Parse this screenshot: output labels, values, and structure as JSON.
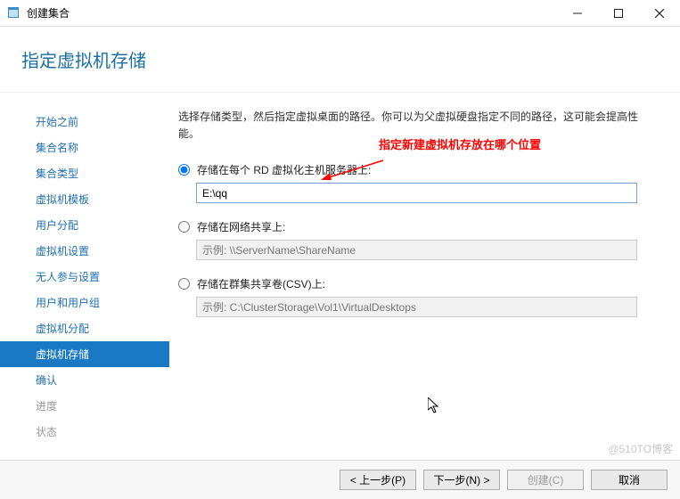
{
  "titlebar": {
    "title": "创建集合"
  },
  "header": {
    "title": "指定虚拟机存储"
  },
  "sidebar": {
    "items": [
      {
        "label": "开始之前"
      },
      {
        "label": "集合名称"
      },
      {
        "label": "集合类型"
      },
      {
        "label": "虚拟机模板"
      },
      {
        "label": "用户分配"
      },
      {
        "label": "虚拟机设置"
      },
      {
        "label": "无人参与设置"
      },
      {
        "label": "用户和用户组"
      },
      {
        "label": "虚拟机分配"
      },
      {
        "label": "虚拟机存储",
        "active": true
      },
      {
        "label": "确认"
      },
      {
        "label": "进度",
        "muted": true
      },
      {
        "label": "状态",
        "muted": true
      }
    ]
  },
  "main": {
    "description": "选择存储类型，然后指定虚拟桌面的路径。你可以为父虚拟硬盘指定不同的路径，这可能会提高性能。",
    "annotation": "指定新建虚拟机存放在哪个位置",
    "options": [
      {
        "key": "rd_host",
        "label": "存储在每个 RD 虚拟化主机服务器上:",
        "value": "E:\\qq",
        "placeholder": "",
        "checked": true,
        "disabled": false
      },
      {
        "key": "network_share",
        "label": "存储在网络共享上:",
        "value": "",
        "placeholder": "示例: \\\\ServerName\\ShareName",
        "checked": false,
        "disabled": true
      },
      {
        "key": "csv",
        "label": "存储在群集共享卷(CSV)上:",
        "value": "",
        "placeholder": "示例: C:\\ClusterStorage\\Vol1\\VirtualDesktops",
        "checked": false,
        "disabled": true
      }
    ]
  },
  "footer": {
    "prev": "< 上一步(P)",
    "next": "下一步(N) >",
    "create": "创建(C)",
    "cancel": "取消"
  },
  "watermark": "@510TO博客"
}
